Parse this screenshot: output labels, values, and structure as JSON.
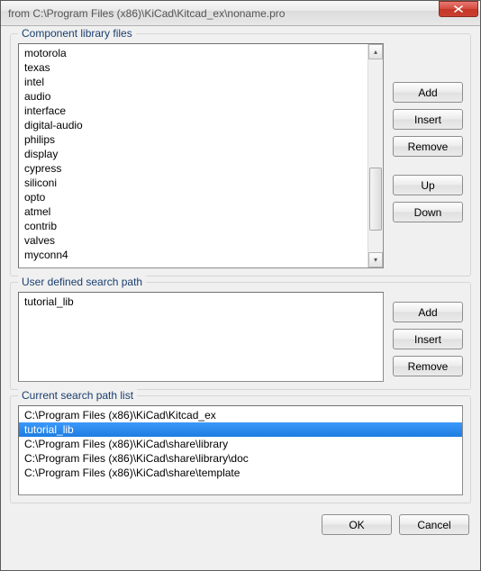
{
  "window": {
    "title": "from C:\\Program Files (x86)\\KiCad\\Kitcad_ex\\noname.pro"
  },
  "sections": {
    "componentLibs": {
      "label": "Component library files"
    },
    "userPaths": {
      "label": "User defined search path"
    },
    "searchPaths": {
      "label": "Current search path list"
    }
  },
  "componentLibs": {
    "items": [
      "motorola",
      "texas",
      "intel",
      "audio",
      "interface",
      "digital-audio",
      "philips",
      "display",
      "cypress",
      "siliconi",
      "opto",
      "atmel",
      "contrib",
      "valves",
      "myconn4"
    ]
  },
  "userPaths": {
    "items": [
      "tutorial_lib"
    ]
  },
  "searchPaths": {
    "items": [
      "C:\\Program Files (x86)\\KiCad\\Kitcad_ex",
      "tutorial_lib",
      "C:\\Program Files (x86)\\KiCad\\share\\library",
      "C:\\Program Files (x86)\\KiCad\\share\\library\\doc",
      "C:\\Program Files (x86)\\KiCad\\share\\template"
    ],
    "selectedIndex": 1
  },
  "buttons": {
    "add": "Add",
    "insert": "Insert",
    "remove": "Remove",
    "up": "Up",
    "down": "Down",
    "ok": "OK",
    "cancel": "Cancel"
  }
}
